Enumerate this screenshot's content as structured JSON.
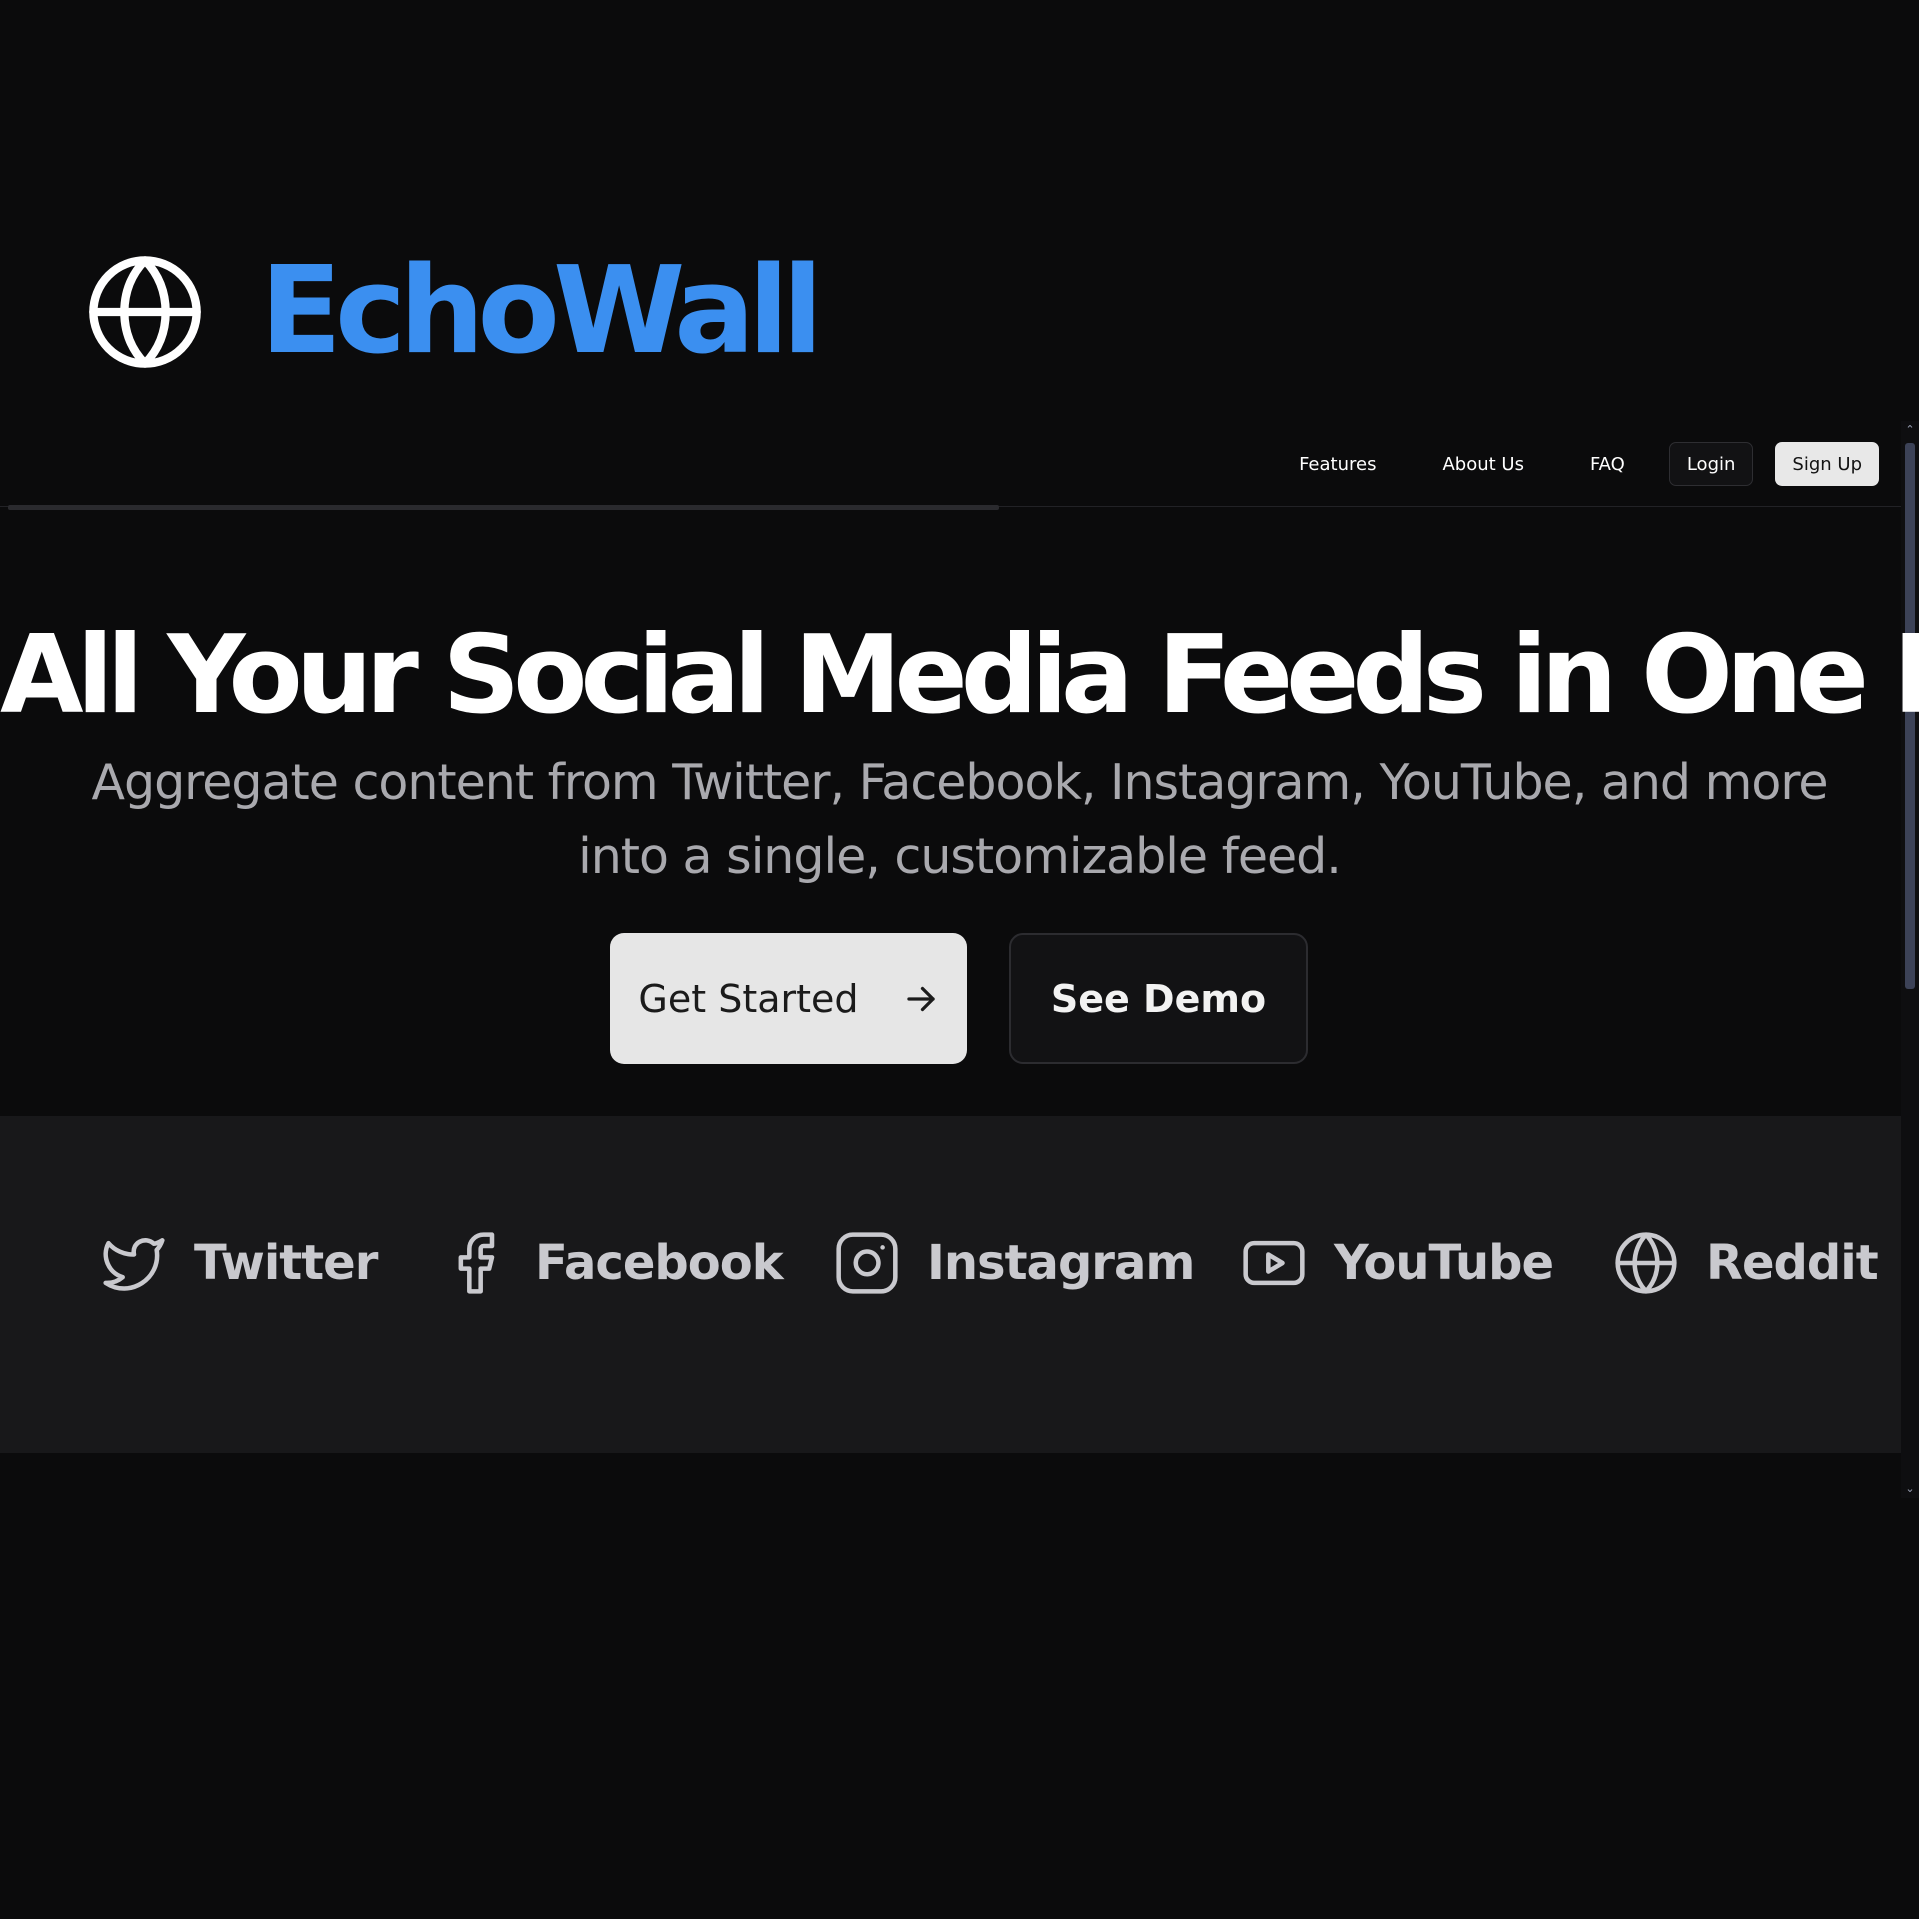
{
  "brand": {
    "name": "EchoWall",
    "icon": "globe-icon",
    "color": "#3b8ff0"
  },
  "nav": {
    "links": [
      "Features",
      "About Us",
      "FAQ"
    ],
    "login_label": "Login",
    "signup_label": "Sign Up"
  },
  "hero": {
    "title": "All Your Social Media Feeds in One Place",
    "subtitle": "Aggregate content from Twitter, Facebook, Instagram, YouTube, and more into a single, customizable feed.",
    "primary_cta": "Get Started",
    "primary_cta_icon": "arrow-right-icon",
    "secondary_cta": "See Demo"
  },
  "platforms": [
    {
      "label": "Twitter",
      "icon": "twitter-icon"
    },
    {
      "label": "Facebook",
      "icon": "facebook-icon"
    },
    {
      "label": "Instagram",
      "icon": "instagram-icon"
    },
    {
      "label": "YouTube",
      "icon": "youtube-icon"
    },
    {
      "label": "Reddit",
      "icon": "globe-icon"
    }
  ],
  "colors": {
    "background": "#0b0b0c",
    "band": "#18181a",
    "accent": "#3b8ff0",
    "primary_button": "#e6e6e6"
  }
}
